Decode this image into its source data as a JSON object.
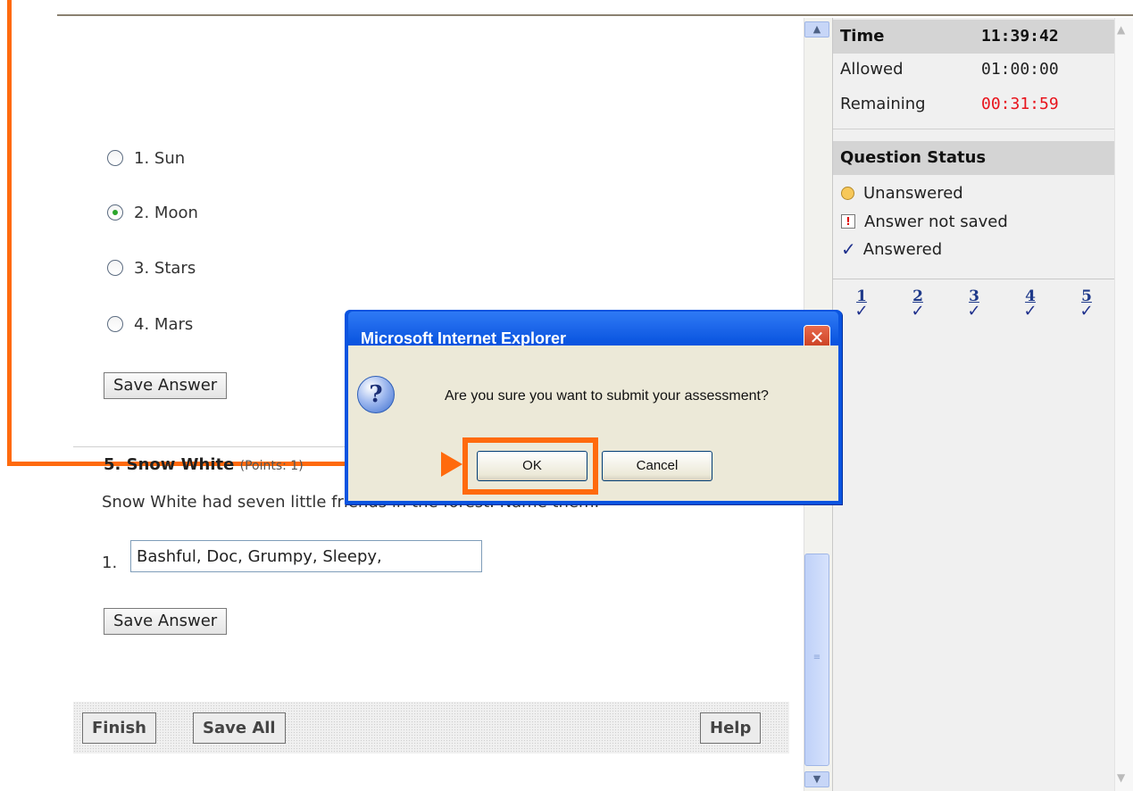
{
  "question4": {
    "options": [
      {
        "number": "1.",
        "label": "Sun",
        "selected": false
      },
      {
        "number": "2.",
        "label": "Moon",
        "selected": true
      },
      {
        "number": "3.",
        "label": "Stars",
        "selected": false
      },
      {
        "number": "4.",
        "label": "Mars",
        "selected": false
      }
    ],
    "save_label": "Save Answer"
  },
  "question5": {
    "title": "5. Snow White",
    "points": "(Points: 1)",
    "text": "Snow White had seven little friends in the forest. Name them.",
    "blank_number": "1.",
    "blank_value": "Bashful, Doc, Grumpy, Sleepy,",
    "save_label": "Save Answer"
  },
  "footer": {
    "finish": "Finish",
    "save_all": "Save All",
    "help": "Help"
  },
  "timer": {
    "time_label": "Time",
    "time_value": "11:39:42",
    "allowed_label": "Allowed",
    "allowed_value": "01:00:00",
    "remaining_label": "Remaining",
    "remaining_value": "00:31:59",
    "remaining_color": "#e8141c"
  },
  "status": {
    "heading": "Question Status",
    "unanswered": "Unanswered",
    "not_saved": "Answer not saved",
    "answered": "Answered",
    "not_saved_glyph": "!",
    "check_glyph": "✓"
  },
  "question_links": [
    "1",
    "2",
    "3",
    "4",
    "5"
  ],
  "dialog": {
    "title": "Microsoft Internet Explorer",
    "message": "Are you sure you want to submit your assessment?",
    "ok": "OK",
    "cancel": "Cancel",
    "icon": "question-icon"
  },
  "annotation_color": "#ff6a0d"
}
